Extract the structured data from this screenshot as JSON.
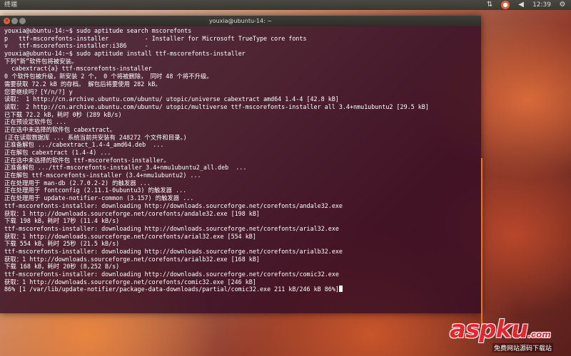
{
  "panel": {
    "title": "终端",
    "clock": "12:39",
    "icons": [
      "arrows-updown-icon",
      "status-icon",
      "volume-icon",
      "gear-icon"
    ]
  },
  "window": {
    "title": "youxia@ubuntu-14: ~"
  },
  "terminal": {
    "lines": [
      "youxia@ubuntu-14:~$ sudo aptitude search mscorefonts",
      "p   ttf-mscorefonts-installer          - Installer for Microsoft TrueType core fonts",
      "v   ttf-mscorefonts-installer:i386     -",
      "youxia@ubuntu-14:~$ sudo aptitude install ttf-mscorefonts-installer",
      "下列“新”软件包将被安装。",
      "  cabextract{a} ttf-mscorefonts-installer",
      "0 个软件包被升级，新安装 2 个， 0 个将被删除， 同时 48 个将不升级。",
      "需要获取 72.2 kB 的存档。 解包后将要使用 282 kB。",
      "您要继续吗？[Y/n/?] y",
      "读取： 1 http://cn.archive.ubuntu.com/ubuntu/ utopic/universe cabextract amd64 1.4-4 [42.8 kB]",
      "读取： 2 http://cn.archive.ubuntu.com/ubuntu/ utopic/multiverse ttf-mscorefonts-installer all 3.4+nmu1ubuntu2 [29.5 kB]",
      "已下载 72.2 kB，耗时 0秒 (289 kB/s)",
      "正在预设定软件包 ...",
      "正在选中未选择的软件包 cabextract。",
      "(正在读取数据库 ... 系统当前共安装有 248272 个文件和目录。)",
      "正准备解包 .../cabextract_1.4-4_amd64.deb  ...",
      "正在解包 cabextract (1.4-4) ...",
      "正在选中未选择的软件包 ttf-mscorefonts-installer。",
      "正准备解包 .../ttf-mscorefonts-installer_3.4+nmu1ubuntu2_all.deb  ...",
      "正在解包 ttf-mscorefonts-installer (3.4+nmu1ubuntu2) ...",
      "正在处理用于 man-db (2.7.0.2-2) 的触发器 ...",
      "正在处理用于 fontconfig (2.11.1-0ubuntu3) 的触发器 ...",
      "正在处理用于 update-notifier-common (3.157) 的触发器 ...",
      "ttf-mscorefonts-installer: downloading http://downloads.sourceforge.net/corefonts/andale32.exe",
      "获取：1 http://downloads.sourceforge.net/corefonts/andale32.exe [198 kB]",
      "下载 198 kB，耗时 17秒 (11.4 kB/s)",
      "ttf-mscorefonts-installer: downloading http://downloads.sourceforge.net/corefonts/arial32.exe",
      "获取：1 http://downloads.sourceforge.net/corefonts/arial32.exe [554 kB]",
      "下载 554 kB，耗时 25秒 (21.5 kB/s)",
      "ttf-mscorefonts-installer: downloading http://downloads.sourceforge.net/corefonts/arialb32.exe",
      "获取：1 http://downloads.sourceforge.net/corefonts/arialb32.exe [168 kB]",
      "下载 168 kB，耗时 20秒 (8,252 B/s)",
      "ttf-mscorefonts-installer: downloading http://downloads.sourceforge.net/corefonts/comic32.exe",
      "获取：1 http://downloads.sourceforge.net/corefonts/comic32.exe [246 kB]",
      "86% [1 /var/lib/update-notifier/package-data-downloads/partial/comic32.exe 211 kB/246 kB 86%]"
    ]
  },
  "watermark": {
    "text": "aspku",
    "suffix": ".com",
    "subtext": "免费网站源码下载站"
  }
}
